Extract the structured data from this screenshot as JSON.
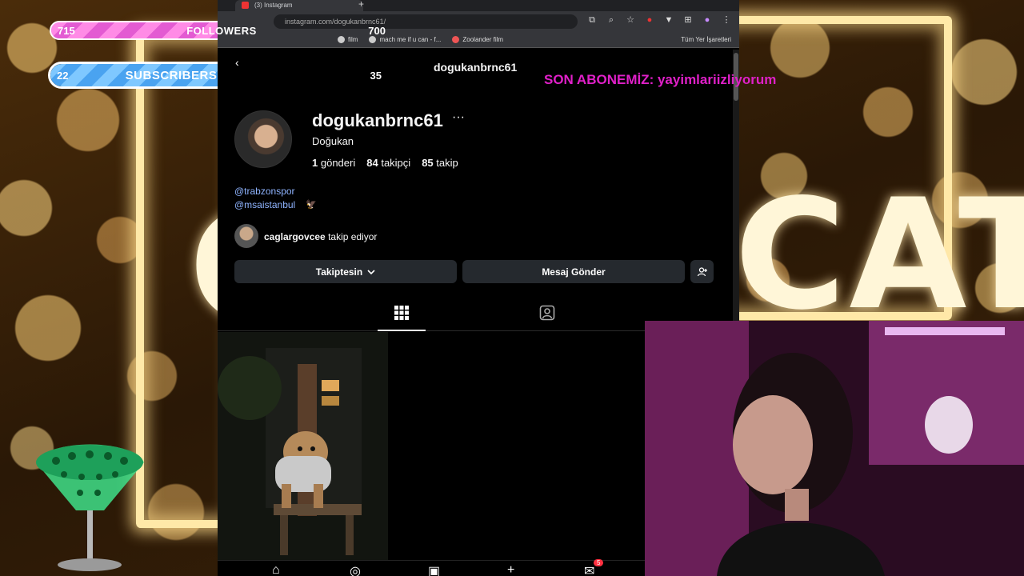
{
  "overlay": {
    "followers": {
      "current": "715",
      "goal": "700",
      "label": "FOLLOWERS",
      "progress": 1.0
    },
    "subscribers": {
      "current": "22",
      "goal": "35",
      "label": "SUBSCRIBERS",
      "progress": 0.63
    },
    "last_subscriber": "SON ABONEMİZ: yayimlariizliyorum"
  },
  "browser": {
    "tab_title": "(3) Instagram",
    "url": "instagram.com/dogukanbrnc61/",
    "bookmarks": [
      "film",
      "mach me if u can - f...",
      "Zoolander film"
    ],
    "all_bookmarks_label": "Tüm Yer İşaretleri"
  },
  "profile": {
    "header_username": "dogukanbrnc61",
    "username": "dogukanbrnc61",
    "more_label": "···",
    "display_name": "Doğukan",
    "posts_count": "1",
    "posts_label": "gönderi",
    "followers_count": "84",
    "followers_label": "takipçi",
    "following_count": "85",
    "following_label": "takip",
    "bio_links": [
      "@trabzonspor",
      "@msaistanbul"
    ],
    "followed_by_user": "caglargovcee",
    "followed_by_suffix": "takip ediyor",
    "following_button": "Takiptesin",
    "message_button": "Mesaj Gönder",
    "notification_badge": "5"
  },
  "colors": {
    "followers_fill": "#ff8be6",
    "subscribers_fill": "#7fc8ff",
    "last_subscriber_text": "#e020c8",
    "bio_link": "#8fb4ff",
    "button_bg": "#25292e"
  },
  "icons": [
    "chevron-down-icon",
    "more-icon",
    "add-person-icon",
    "grid-icon",
    "tagged-icon",
    "home-icon",
    "explore-icon",
    "reels-icon",
    "create-icon",
    "messages-icon"
  ]
}
